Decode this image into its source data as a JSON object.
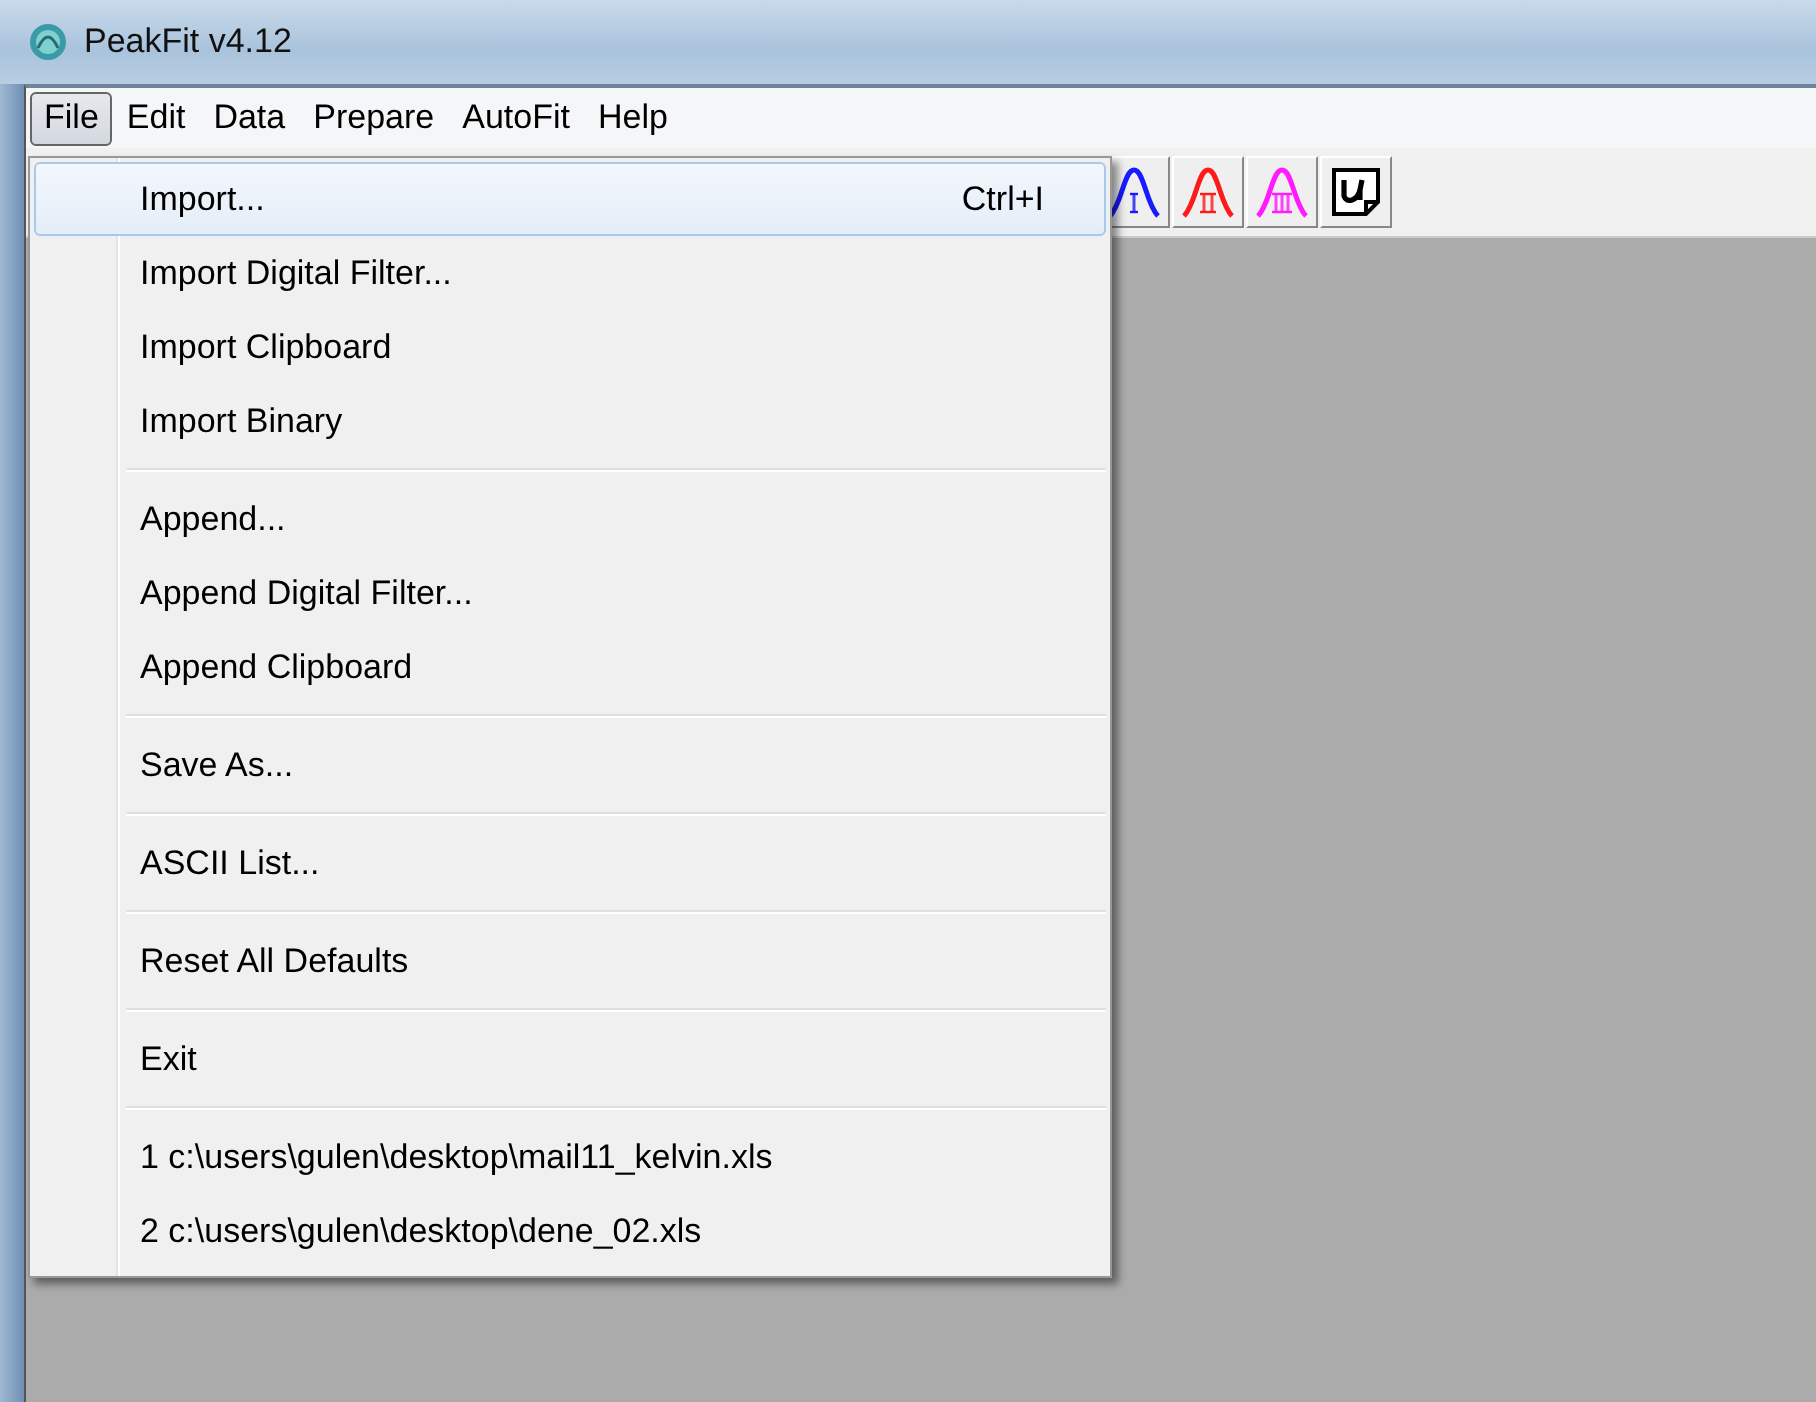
{
  "window": {
    "title": "PeakFit v4.12"
  },
  "menu_bar": [
    {
      "label": "File",
      "selected": true
    },
    {
      "label": "Edit",
      "selected": false
    },
    {
      "label": "Data",
      "selected": false
    },
    {
      "label": "Prepare",
      "selected": false
    },
    {
      "label": "AutoFit",
      "selected": false
    },
    {
      "label": "Help",
      "selected": false
    }
  ],
  "toolbar": [
    {
      "kind": "peak",
      "color": "#1a1aff"
    },
    {
      "kind": "peak",
      "color": "#ff1a1a"
    },
    {
      "kind": "peak",
      "color": "#ff1aff"
    },
    {
      "kind": "user"
    }
  ],
  "file_menu": {
    "groups": [
      [
        {
          "label": "Import...",
          "shortcut": "Ctrl+I",
          "selected": true
        },
        {
          "label": "Import Digital Filter...",
          "selected": false
        },
        {
          "label": "Import Clipboard",
          "selected": false
        },
        {
          "label": "Import Binary",
          "selected": false
        }
      ],
      [
        {
          "label": "Append...",
          "selected": false
        },
        {
          "label": "Append Digital Filter...",
          "selected": false
        },
        {
          "label": "Append Clipboard",
          "selected": false
        }
      ],
      [
        {
          "label": "Save As...",
          "selected": false
        }
      ],
      [
        {
          "label": "ASCII List...",
          "selected": false
        }
      ],
      [
        {
          "label": "Reset All Defaults",
          "selected": false
        }
      ],
      [
        {
          "label": "Exit",
          "selected": false
        }
      ],
      [
        {
          "label": "1 c:\\users\\gulen\\desktop\\mail11_kelvin.xls",
          "selected": false
        },
        {
          "label": "2 c:\\users\\gulen\\desktop\\dene_02.xls",
          "selected": false
        }
      ]
    ]
  }
}
